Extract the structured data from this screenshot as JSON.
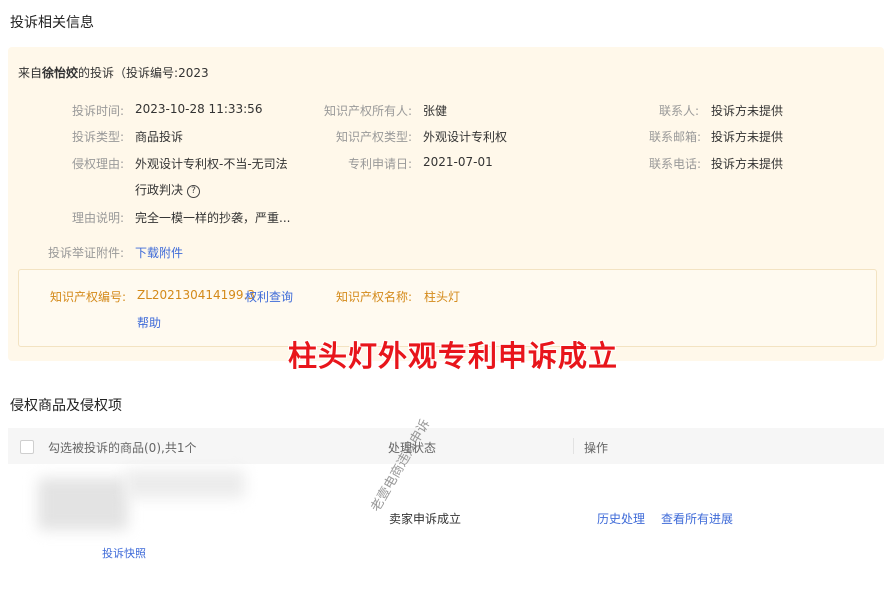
{
  "header": {
    "title": "投诉相关信息"
  },
  "complaint": {
    "from_prefix": "来自",
    "complainant": "徐怡姣",
    "from_suffix": "的投诉（投诉编号:2023",
    "rows": {
      "time_label": "投诉时间:",
      "time_value": "2023-10-28 11:33:56",
      "type_label": "投诉类型:",
      "type_value": "商品投诉",
      "reason_label": "侵权理由:",
      "reason_value_1": "外观设计专利权-不当-无司法",
      "reason_value_2": "行政判决",
      "desc_label": "理由说明:",
      "desc_value": "完全一模一样的抄袭，严重...",
      "evidence_label": "投诉举证附件:",
      "evidence_link": "下载附件",
      "owner_label": "知识产权所有人:",
      "owner_value": "张健",
      "iptype_label": "知识产权类型:",
      "iptype_value": "外观设计专利权",
      "apply_label": "专利申请日:",
      "apply_value": "2021-07-01",
      "contact_label": "联系人:",
      "contact_value": "投诉方未提供",
      "email_label": "联系邮箱:",
      "email_value": "投诉方未提供",
      "phone_label": "联系电话:",
      "phone_value": "投诉方未提供"
    },
    "ip": {
      "no_label": "知识产权编号:",
      "no_value": "ZL202130414199.3",
      "query_link": "权利查询",
      "help_link": "帮助",
      "name_label": "知识产权名称:",
      "name_value": "柱头灯"
    }
  },
  "banner": "柱头灯外观专利申诉成立",
  "goods": {
    "title": "侵权商品及侵权项",
    "columns": {
      "select": "勾选被投诉的商品(0),共1个",
      "status": "处理状态",
      "action": "操作"
    },
    "row": {
      "snapshot_link": "投诉快照",
      "status": "卖家申诉成立",
      "history_link": "历史处理",
      "progress_link": "查看所有进展"
    }
  },
  "watermark": "老壹电商违规申诉",
  "icons": {
    "help": "question-circle-icon"
  }
}
